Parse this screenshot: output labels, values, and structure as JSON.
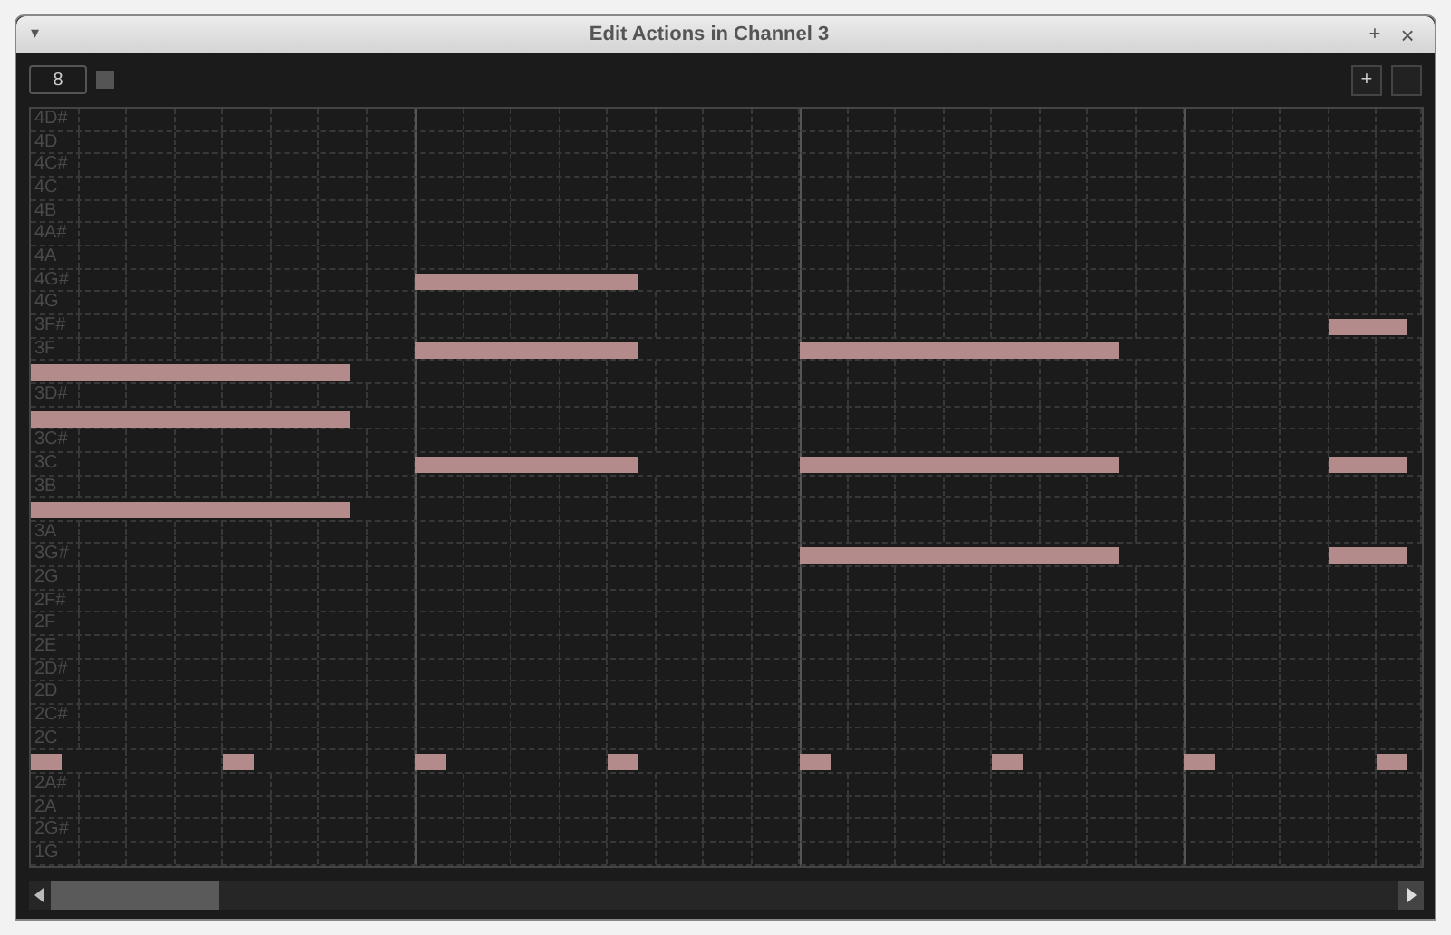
{
  "window": {
    "title": "Edit Actions in Channel 3",
    "menu_glyph": "▾",
    "pin_glyph": "+",
    "close_glyph": "×"
  },
  "toolbar": {
    "value_field": "8",
    "add_button": "+"
  },
  "piano_roll": {
    "rows": [
      {
        "label": "4D#"
      },
      {
        "label": "4D"
      },
      {
        "label": "4C#"
      },
      {
        "label": "4C"
      },
      {
        "label": "4B"
      },
      {
        "label": "4A#"
      },
      {
        "label": "4A"
      },
      {
        "label": "4G#",
        "steps": [
          false,
          false,
          false,
          false,
          false,
          false,
          false,
          false,
          true,
          true,
          true,
          true,
          true
        ]
      },
      {
        "label": "4G"
      },
      {
        "label": "3F#",
        "steps": [
          false,
          false,
          false,
          false,
          false,
          false,
          false,
          false,
          false,
          false,
          false,
          false,
          false,
          false,
          false,
          false,
          false,
          false,
          false,
          false,
          false,
          false,
          false,
          false,
          false,
          false,
          false,
          true,
          true
        ]
      },
      {
        "label": "3F",
        "steps": [
          false,
          false,
          false,
          false,
          false,
          false,
          false,
          false,
          true,
          true,
          true,
          true,
          true,
          false,
          false,
          false,
          true,
          true,
          true,
          true,
          true,
          true,
          true
        ]
      },
      {
        "steps": [
          true,
          true,
          true,
          true,
          true,
          true,
          true
        ]
      },
      {
        "label": "3D#"
      },
      {
        "steps": [
          true,
          true,
          true,
          true,
          true,
          true,
          true
        ]
      },
      {
        "label": "3C#"
      },
      {
        "label": "3C",
        "steps": [
          false,
          false,
          false,
          false,
          false,
          false,
          false,
          false,
          true,
          true,
          true,
          true,
          true,
          false,
          false,
          false,
          true,
          true,
          true,
          true,
          true,
          true,
          true,
          false,
          false,
          false,
          false,
          true,
          true
        ]
      },
      {
        "label": "3B"
      },
      {
        "steps": [
          true,
          true,
          true,
          true,
          true,
          true,
          true
        ]
      },
      {
        "label": "3A"
      },
      {
        "label": "3G#",
        "steps": [
          false,
          false,
          false,
          false,
          false,
          false,
          false,
          false,
          false,
          false,
          false,
          false,
          false,
          false,
          false,
          false,
          true,
          true,
          true,
          true,
          true,
          true,
          true,
          false,
          false,
          false,
          false,
          true,
          true
        ]
      },
      {
        "label": "2G"
      },
      {
        "label": "2F#"
      },
      {
        "label": "2F"
      },
      {
        "label": "2E"
      },
      {
        "label": "2D#"
      },
      {
        "label": "2D"
      },
      {
        "label": "2C#"
      },
      {
        "label": "2C"
      },
      {
        "steps": [
          true,
          false,
          false,
          false,
          true,
          false,
          false,
          false,
          true,
          false,
          false,
          false,
          true,
          false,
          false,
          false,
          true,
          false,
          false,
          false,
          true,
          false,
          false,
          false,
          true,
          false,
          false,
          false,
          true
        ]
      },
      {
        "label": "2A#"
      },
      {
        "label": "2A"
      },
      {
        "label": "2G#"
      },
      {
        "label": "1G"
      }
    ]
  },
  "scrollbar": {
    "level": 0.125
  }
}
